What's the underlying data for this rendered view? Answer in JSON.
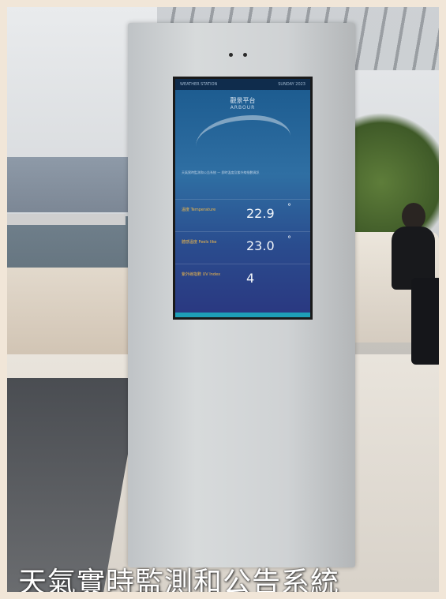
{
  "screen": {
    "header_left": "WEATHER STATION",
    "header_right": "SUNDAY 2023",
    "title": "觀景平台",
    "subtitle": "ARBOUR",
    "paragraph": "天氣實時監測和公告系統 — 即時溫度及紫外線指數資訊",
    "readings": [
      {
        "label": "溫度 Temperature",
        "value": "22.9",
        "unit": "°"
      },
      {
        "label": "體感溫度 Feels like",
        "value": "23.0",
        "unit": "°"
      },
      {
        "label": "紫外線指數 UV Index",
        "value": "4",
        "unit": ""
      }
    ]
  },
  "caption": "天氣實時監測和公告系統"
}
